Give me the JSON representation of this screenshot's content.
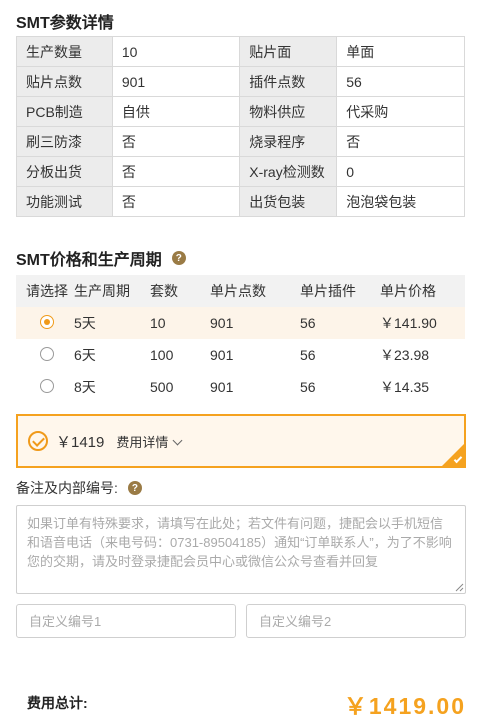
{
  "sections": {
    "params_title": "SMT参数详情",
    "price_title": "SMT价格和生产周期",
    "help_glyph": "?"
  },
  "params": [
    {
      "l1": "生产数量",
      "v1": "10",
      "l2": "贴片面",
      "v2": "单面"
    },
    {
      "l1": "贴片点数",
      "v1": "901",
      "l2": "插件点数",
      "v2": "56"
    },
    {
      "l1": "PCB制造",
      "v1": "自供",
      "l2": "物料供应",
      "v2": "代采购"
    },
    {
      "l1": "刷三防漆",
      "v1": "否",
      "l2": "烧录程序",
      "v2": "否"
    },
    {
      "l1": "分板出货",
      "v1": "否",
      "l2": "X-ray检测数",
      "v2": "0"
    },
    {
      "l1": "功能测试",
      "v1": "否",
      "l2": "出货包装",
      "v2": "泡泡袋包装"
    }
  ],
  "price_table": {
    "headers": [
      "请选择",
      "生产周期",
      "套数",
      "单片点数",
      "单片插件",
      "单片价格"
    ],
    "rows": [
      {
        "cycle": "5天",
        "sets": "10",
        "points": "901",
        "plugins": "56",
        "price": "￥141.90",
        "selected": true
      },
      {
        "cycle": "6天",
        "sets": "100",
        "points": "901",
        "plugins": "56",
        "price": "￥23.98",
        "selected": false
      },
      {
        "cycle": "8天",
        "sets": "500",
        "points": "901",
        "plugins": "56",
        "price": "￥14.35",
        "selected": false
      }
    ]
  },
  "summary": {
    "price": "￥1419",
    "detail_label": "费用详情"
  },
  "remarks": {
    "label": "备注及内部编号:",
    "placeholder": "如果订单有特殊要求，请填写在此处；若文件有问题，捷配会以手机短信和语音电话（来电号码：0731-89504185）通知“订单联系人”，为了不影响您的交期，请及时登录捷配会员中心或微信公众号查看并回复",
    "custom1_placeholder": "自定义编号1",
    "custom2_placeholder": "自定义编号2"
  },
  "total": {
    "label": "费用总计:",
    "value": "￥1419.00"
  },
  "colors": {
    "accent": "#f5a21f",
    "selected_row": "#fdf4e9",
    "help_icon": "#9a7b45"
  }
}
